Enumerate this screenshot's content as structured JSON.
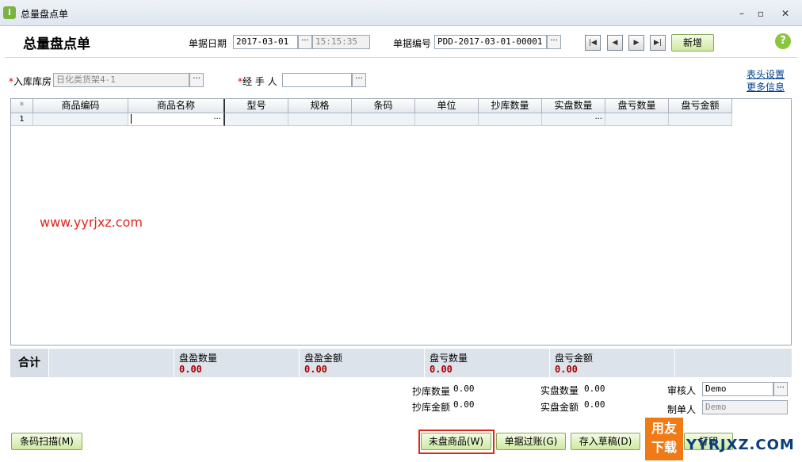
{
  "window": {
    "title": "总量盘点单",
    "minimize_glyph": "–",
    "restore_glyph": "▫",
    "close_glyph": "✕"
  },
  "header": {
    "page_title": "总量盘点单",
    "date_label": "单据日期",
    "date_value": "2017-03-01",
    "time_value": "15:15:35",
    "docno_label": "单据编号",
    "docno_value": "PDD-2017-03-01-00001",
    "new_button": "新增",
    "help_glyph": "?"
  },
  "form": {
    "warehouse_label": "入库库房",
    "warehouse_value": "日化类货架4-1",
    "handler_label": "经 手 人",
    "handler_value": "",
    "header_settings_link": "表头设置",
    "more_info_link": "更多信息"
  },
  "grid": {
    "columns": [
      "*",
      "商品编码",
      "商品名称",
      "型号",
      "规格",
      "条码",
      "单位",
      "抄库数量",
      "实盘数量",
      "盘亏数量",
      "盘亏金额"
    ],
    "rows": [
      {
        "index": "1"
      }
    ]
  },
  "totals": {
    "label": "合计",
    "gain_qty_label": "盘盈数量",
    "gain_qty_value": "0.00",
    "gain_amt_label": "盘盈金额",
    "gain_amt_value": "0.00",
    "loss_qty_label": "盘亏数量",
    "loss_qty_value": "0.00",
    "loss_amt_label": "盘亏金额",
    "loss_amt_value": "0.00"
  },
  "summary": {
    "book_qty_label": "抄库数量",
    "book_qty_value": "0.00",
    "book_amt_label": "抄库金额",
    "book_amt_value": "0.00",
    "actual_qty_label": "实盘数量",
    "actual_qty_value": "0.00",
    "actual_amt_label": "实盘金额",
    "actual_amt_value": "0.00",
    "auditor_label": "审核人",
    "auditor_value": "Demo",
    "maker_label": "制单人",
    "maker_value": "Demo"
  },
  "buttons": {
    "barcode_scan": "条码扫描(M)",
    "unchecked_goods": "未盘商品(W)",
    "post": "单据过账(G)",
    "save_draft": "存入草稿(D)",
    "print": "打印"
  },
  "watermark": {
    "url": "www.yyrjxz.com",
    "badge_line1": "用友",
    "badge_line2": "下载",
    "logo_text": "YYRJXZ.COM"
  }
}
